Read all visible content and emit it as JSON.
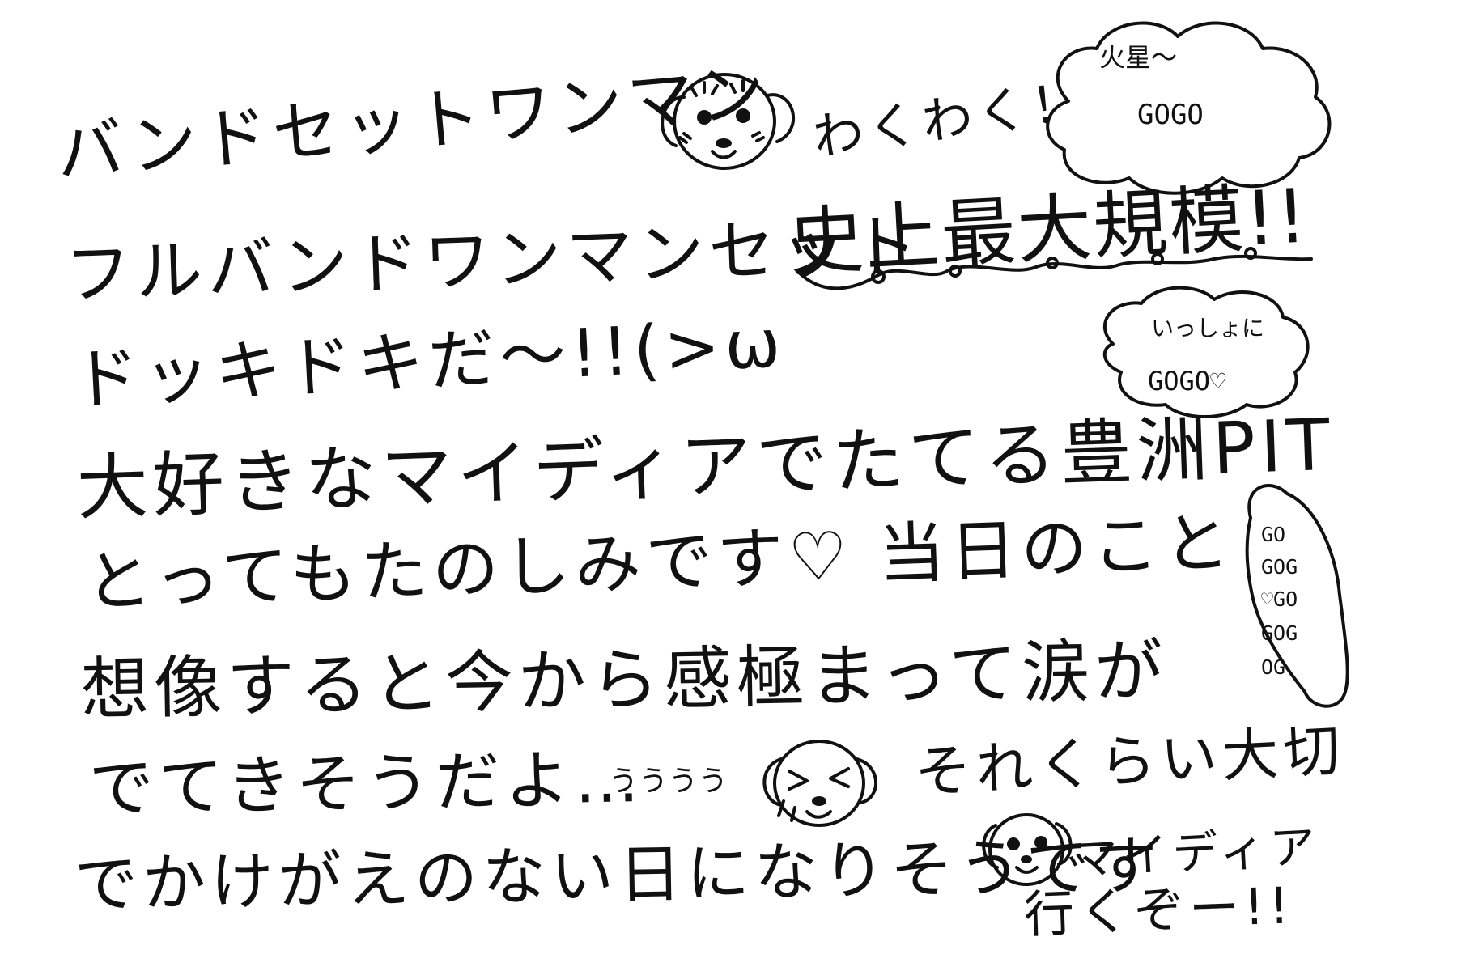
{
  "lines": [
    "バンドセットワンマン",
    "わくわく！",
    "フルバンドワンマンセット",
    "史上最大規模!!",
    "ドッキドキだ～!!(>ω",
    "大好きなマイディアでたてる豊洲PIT",
    "とってもたのしみです♡ 当日のこと",
    "想像すると今から感極まって涙が",
    "でてきそうだよ…",
    "うううう",
    "それくらい大切",
    "でかけがえのない日になりそうです",
    "マイディア",
    "行くぞー!!"
  ],
  "bubbles": {
    "mars": [
      "火星～",
      "GOGO"
    ],
    "together": [
      "いっしょに",
      "GOGO♡"
    ],
    "column": [
      "GO",
      "GOG",
      "♡GO",
      "GOG",
      "OG"
    ]
  },
  "icons": {
    "dog_happy": "dog-face-happy-icon",
    "dog_crying": "dog-face-crying-icon",
    "dog_small": "dog-face-small-icon"
  },
  "colors": {
    "ink": "#111111",
    "paper": "#ffffff"
  }
}
